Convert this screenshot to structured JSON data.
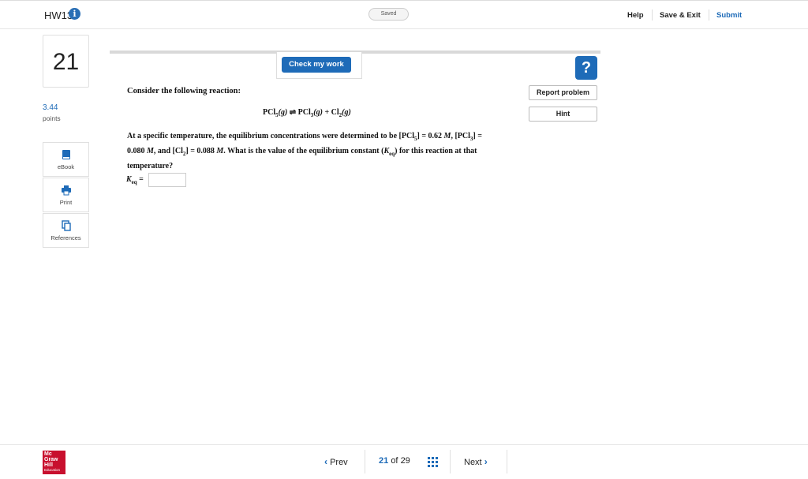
{
  "header": {
    "title": "HW13",
    "info_icon": "info-icon",
    "saved_status": "Saved",
    "help": "Help",
    "save_exit": "Save & Exit",
    "submit": "Submit"
  },
  "sidebar": {
    "question_number": "21",
    "points_value": "3.44",
    "points_label": "points",
    "tools": [
      {
        "label": "eBook",
        "icon": "book-icon"
      },
      {
        "label": "Print",
        "icon": "printer-icon"
      },
      {
        "label": "References",
        "icon": "copy-icon"
      }
    ]
  },
  "main": {
    "check_button": "Check my work",
    "help_icon": "?",
    "report_button": "Report problem",
    "hint_button": "Hint",
    "prompt": "Consider the following reaction:",
    "equation": {
      "reactant": "PCl",
      "reactant_sub": "5",
      "phase": "(g)",
      "arrow": "⇌",
      "product1": "PCl",
      "product1_sub": "3",
      "plus": "+",
      "product2": "Cl",
      "product2_sub": "2"
    },
    "question": {
      "part1": "At a specific temperature, the equilibrium concentrations were determined to be [PCl",
      "sub5": "5",
      "part2": "] = 0.62 ",
      "unit": "M",
      "part3": ", [PCl",
      "sub3": "3",
      "part4": "] = 0.080 ",
      "part5": ", and [Cl",
      "sub2": "2",
      "part6": "] = 0.088 ",
      "part7": ". What is the value of the equilibrium constant (",
      "k": "K",
      "keq_sub": "eq",
      "part8": ") for this reaction at that temperature?"
    },
    "answer_label": "K",
    "answer_label_sub": "eq",
    "answer_eq": " =",
    "answer_value": ""
  },
  "footer": {
    "logo_lines": [
      "Mc",
      "Graw",
      "Hill",
      "Education"
    ],
    "prev": "Prev",
    "current_page": "21",
    "of": "of",
    "total_pages": "29",
    "next": "Next"
  },
  "colors": {
    "accent": "#1e6bb8",
    "logo_red": "#c8102e"
  }
}
